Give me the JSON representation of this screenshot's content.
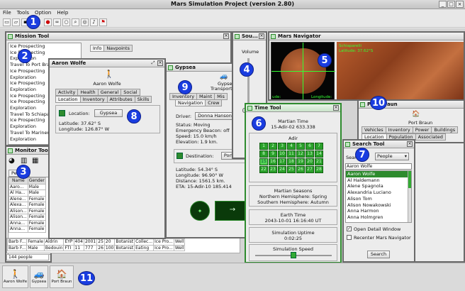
{
  "window": {
    "title": "Mars Simulation Project (version 2.80)"
  },
  "menu": [
    "File",
    "Tools",
    "Option",
    "Help"
  ],
  "toolbar_icons": [
    "new-icon",
    "open-icon",
    "save-icon",
    "save-as-icon",
    "record-icon",
    "binoculars-icon",
    "circle-icon",
    "search-icon",
    "monitor-icon",
    "sound-icon",
    "flag-icon"
  ],
  "mission_tool": {
    "title": "Mission Tool",
    "missions": [
      "Ice Prospecting",
      "Ice Prospecting",
      "Exploration",
      "Travel To Port Braun",
      "Ice Prospecting",
      "Exploration",
      "Ice Prospecting",
      "Exploration",
      "Ice Prospecting",
      "Ice Prospecting",
      "Exploration",
      "Travel To Schiaparelli",
      "Ice Prospecting",
      "Exploration",
      "Travel To Mariner S",
      "Exploration"
    ],
    "tabs": [
      "Info",
      "Navpoints"
    ]
  },
  "monitor_tool": {
    "title": "Monitor Tool",
    "tab": "People",
    "columns": [
      "Name",
      "Gender",
      "",
      "",
      "",
      "",
      "",
      "",
      ""
    ],
    "rows": [
      [
        "Aaro...",
        "Male",
        "",
        "",
        "",
        "",
        "",
        "",
        ""
      ],
      [
        "Al Ha...",
        "Male",
        "",
        "",
        "",
        "",
        "",
        "",
        ""
      ],
      [
        "Alene...",
        "Female",
        "",
        "",
        "",
        "",
        "",
        "",
        ""
      ],
      [
        "Alexa...",
        "Female",
        "",
        "",
        "",
        "",
        "",
        "",
        ""
      ],
      [
        "Alison...",
        "Female",
        "",
        "",
        "",
        "",
        "",
        "",
        ""
      ],
      [
        "Alison...",
        "Female",
        "",
        "",
        "",
        "",
        "",
        "",
        ""
      ],
      [
        "Anna...",
        "Female",
        "",
        "",
        "",
        "",
        "",
        "",
        ""
      ],
      [
        "Anna...",
        "Female",
        "",
        "",
        "",
        "",
        "",
        "",
        ""
      ],
      [
        "Barb F...",
        "Female",
        "Aldrin",
        "EYP",
        "404",
        "2001",
        "25",
        "20",
        "Botanist"
      ],
      [
        "Barb F...",
        "Male",
        "Bedouin",
        "FTI",
        "11",
        "777",
        "26",
        "100",
        "Botanist"
      ]
    ],
    "row_tail": [
      [
        "Collec...",
        "Ice Pro...",
        "Well"
      ],
      [
        "Eating",
        "Ice Pro...",
        "Well"
      ]
    ],
    "status": "144 people"
  },
  "person_window": {
    "title": "Aaron Wolfe",
    "name": "Aaron Wolfe",
    "tabs_row1": [
      "Activity",
      "Health",
      "General",
      "Social"
    ],
    "tabs_row2": [
      "Location",
      "Inventory",
      "Attributes",
      "Skills"
    ],
    "location_label": "Location:",
    "location_value": "Gypsea",
    "latitude": "Latitude: 37.62° S",
    "longitude": "Longitude: 126.87° W"
  },
  "vehicle_window": {
    "title": "Gypsea",
    "name": "Gypsea",
    "subtitle": "Transport R",
    "tabs_row1": [
      "Inventory",
      "Maint",
      "Mis"
    ],
    "tabs_row2": [
      "Navigation",
      "Crew"
    ],
    "driver_label": "Driver:",
    "driver": "Donna Hanson",
    "status": "Status: Moving",
    "beacon": "Emergency Beacon: off",
    "speed": "Speed: 15.0 km/h",
    "elevation": "Elevation: 1.9 km.",
    "destination_label": "Destination:",
    "destination": "Port Braun",
    "latitude": "Latitude: 54.34° S",
    "longitude": "Longitude: 96.90° W",
    "distance": "Distance: 1561.5 km.",
    "eta": "ETA: 15-Adir-10 185.414"
  },
  "sound_window": {
    "title": "Sou...",
    "volume_label": "Volume",
    "volume_level": 0.3
  },
  "navigator": {
    "title": "Mars Navigator",
    "overlay_line1": "Schiaparelli",
    "overlay_line2": "Latitude: 37.62°S",
    "lon_label": "Longitude:",
    "lat_left": "ude:"
  },
  "settlement_window": {
    "title": "Port Braun",
    "name": "Port Braun",
    "tabs_row1": [
      "Vehicles",
      "Inventory",
      "Power",
      "Buildings"
    ],
    "tabs_row2": [
      "Location",
      "Population",
      "Associated"
    ]
  },
  "time_tool": {
    "title": "Time Tool",
    "martian_time_label": "Martian Time",
    "martian_time": "15-Adir-02 633.338",
    "month": "Adir",
    "days": [
      "1",
      "2",
      "3",
      "4",
      "5",
      "6",
      "7",
      "8",
      "9",
      "10",
      "11",
      "12",
      "13",
      "14",
      "15",
      "16",
      "17",
      "18",
      "19",
      "20",
      "21",
      "22",
      "23",
      "24",
      "25",
      "26",
      "27",
      "28"
    ],
    "today": "15",
    "seasons_label": "Martian Seasons",
    "northern": "Northern Hemisphere: Spring",
    "southern": "Southern Hemisphere: Autumn",
    "earth_time_label": "Earth Time",
    "earth_time": "2043-10-01  16:16:40 UT",
    "uptime_label": "Simulation Uptime",
    "uptime": "0:02:25",
    "speed_label": "Simulation Speed",
    "speed_level": 0.5
  },
  "search_tool": {
    "title": "Search Tool",
    "search_label": "Search",
    "category": "People",
    "query": "Aaron Wolfe",
    "results": [
      "Aaron Wolfe",
      "Al Haldemann",
      "Alene Spagnola",
      "Alexandria Luciano",
      "Alison Tom",
      "Alison Nowakowski",
      "Anna Harmon",
      "Anna Holmgren"
    ],
    "open_detail": "Open Detail Window",
    "recenter": "Recenter Mars Navigator",
    "search_button": "Search"
  },
  "taskbar": [
    "Aaron Wolfe",
    "Gypsea",
    "Port Braun"
  ],
  "badges": [
    "1",
    "2",
    "3",
    "4",
    "5",
    "6",
    "7",
    "8",
    "9",
    "10",
    "11"
  ]
}
